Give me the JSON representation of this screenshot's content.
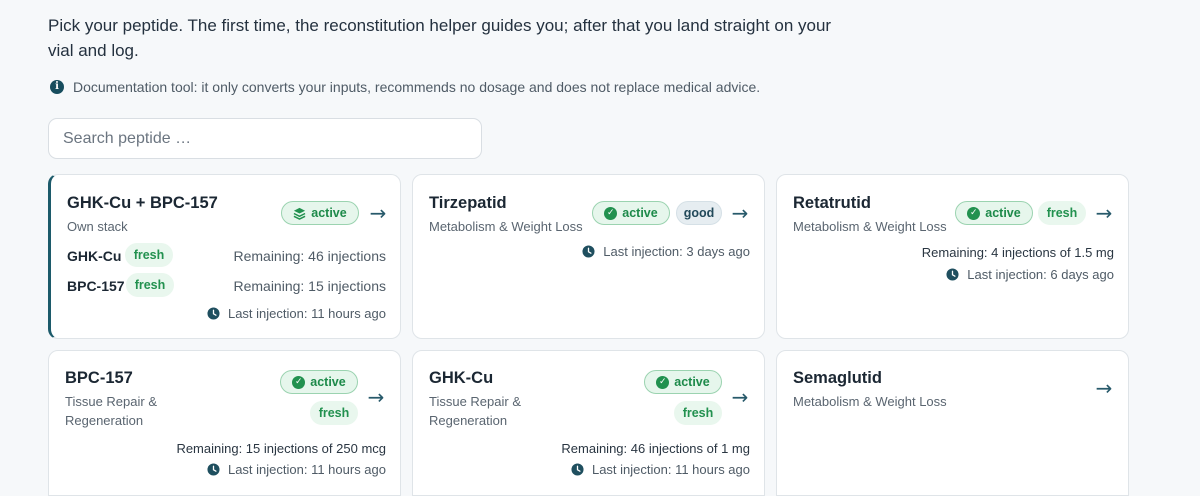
{
  "intro": "Pick your peptide. The first time, the reconstitution helper guides you; after that you land straight on your vial and log.",
  "disclaimer": "Documentation tool: it only converts your inputs, recommends no dosage and does not replace medical advice.",
  "search": {
    "placeholder": "Search peptide …",
    "value": ""
  },
  "colors": {
    "accent": "#1c5a6a",
    "active_green": "#22914f",
    "active_bg": "#e6f6ec",
    "good_bg": "#e6edf1"
  },
  "cards": [
    {
      "title": "GHK-Cu + BPC-157",
      "subtitle": "Own stack",
      "status": "active",
      "status_icon": "stack-icon",
      "components": [
        {
          "name": "GHK-Cu",
          "badge": "fresh",
          "remaining": "Remaining: 46 injections"
        },
        {
          "name": "BPC-157",
          "badge": "fresh",
          "remaining": "Remaining: 15 injections"
        }
      ],
      "last_injection": "Last injection: 11 hours ago"
    },
    {
      "title": "Tirzepatid",
      "subtitle": "Metabolism & Weight Loss",
      "status": "active",
      "badge": "good",
      "last_injection": "Last injection: 3 days ago"
    },
    {
      "title": "Retatrutid",
      "subtitle": "Metabolism & Weight Loss",
      "status": "active",
      "badge": "fresh",
      "remaining": "Remaining: 4 injections of 1.5 mg",
      "last_injection": "Last injection: 6 days ago"
    },
    {
      "title": "BPC-157",
      "subtitle": "Tissue Repair & Regeneration",
      "status": "active",
      "badge": "fresh",
      "remaining": "Remaining: 15 injections of 250 mcg",
      "last_injection": "Last injection: 11 hours ago"
    },
    {
      "title": "GHK-Cu",
      "subtitle": "Tissue Repair & Regeneration",
      "status": "active",
      "badge": "fresh",
      "remaining": "Remaining: 46 injections of 1 mg",
      "last_injection": "Last injection: 11 hours ago"
    },
    {
      "title": "Semaglutid",
      "subtitle": "Metabolism & Weight Loss"
    }
  ]
}
